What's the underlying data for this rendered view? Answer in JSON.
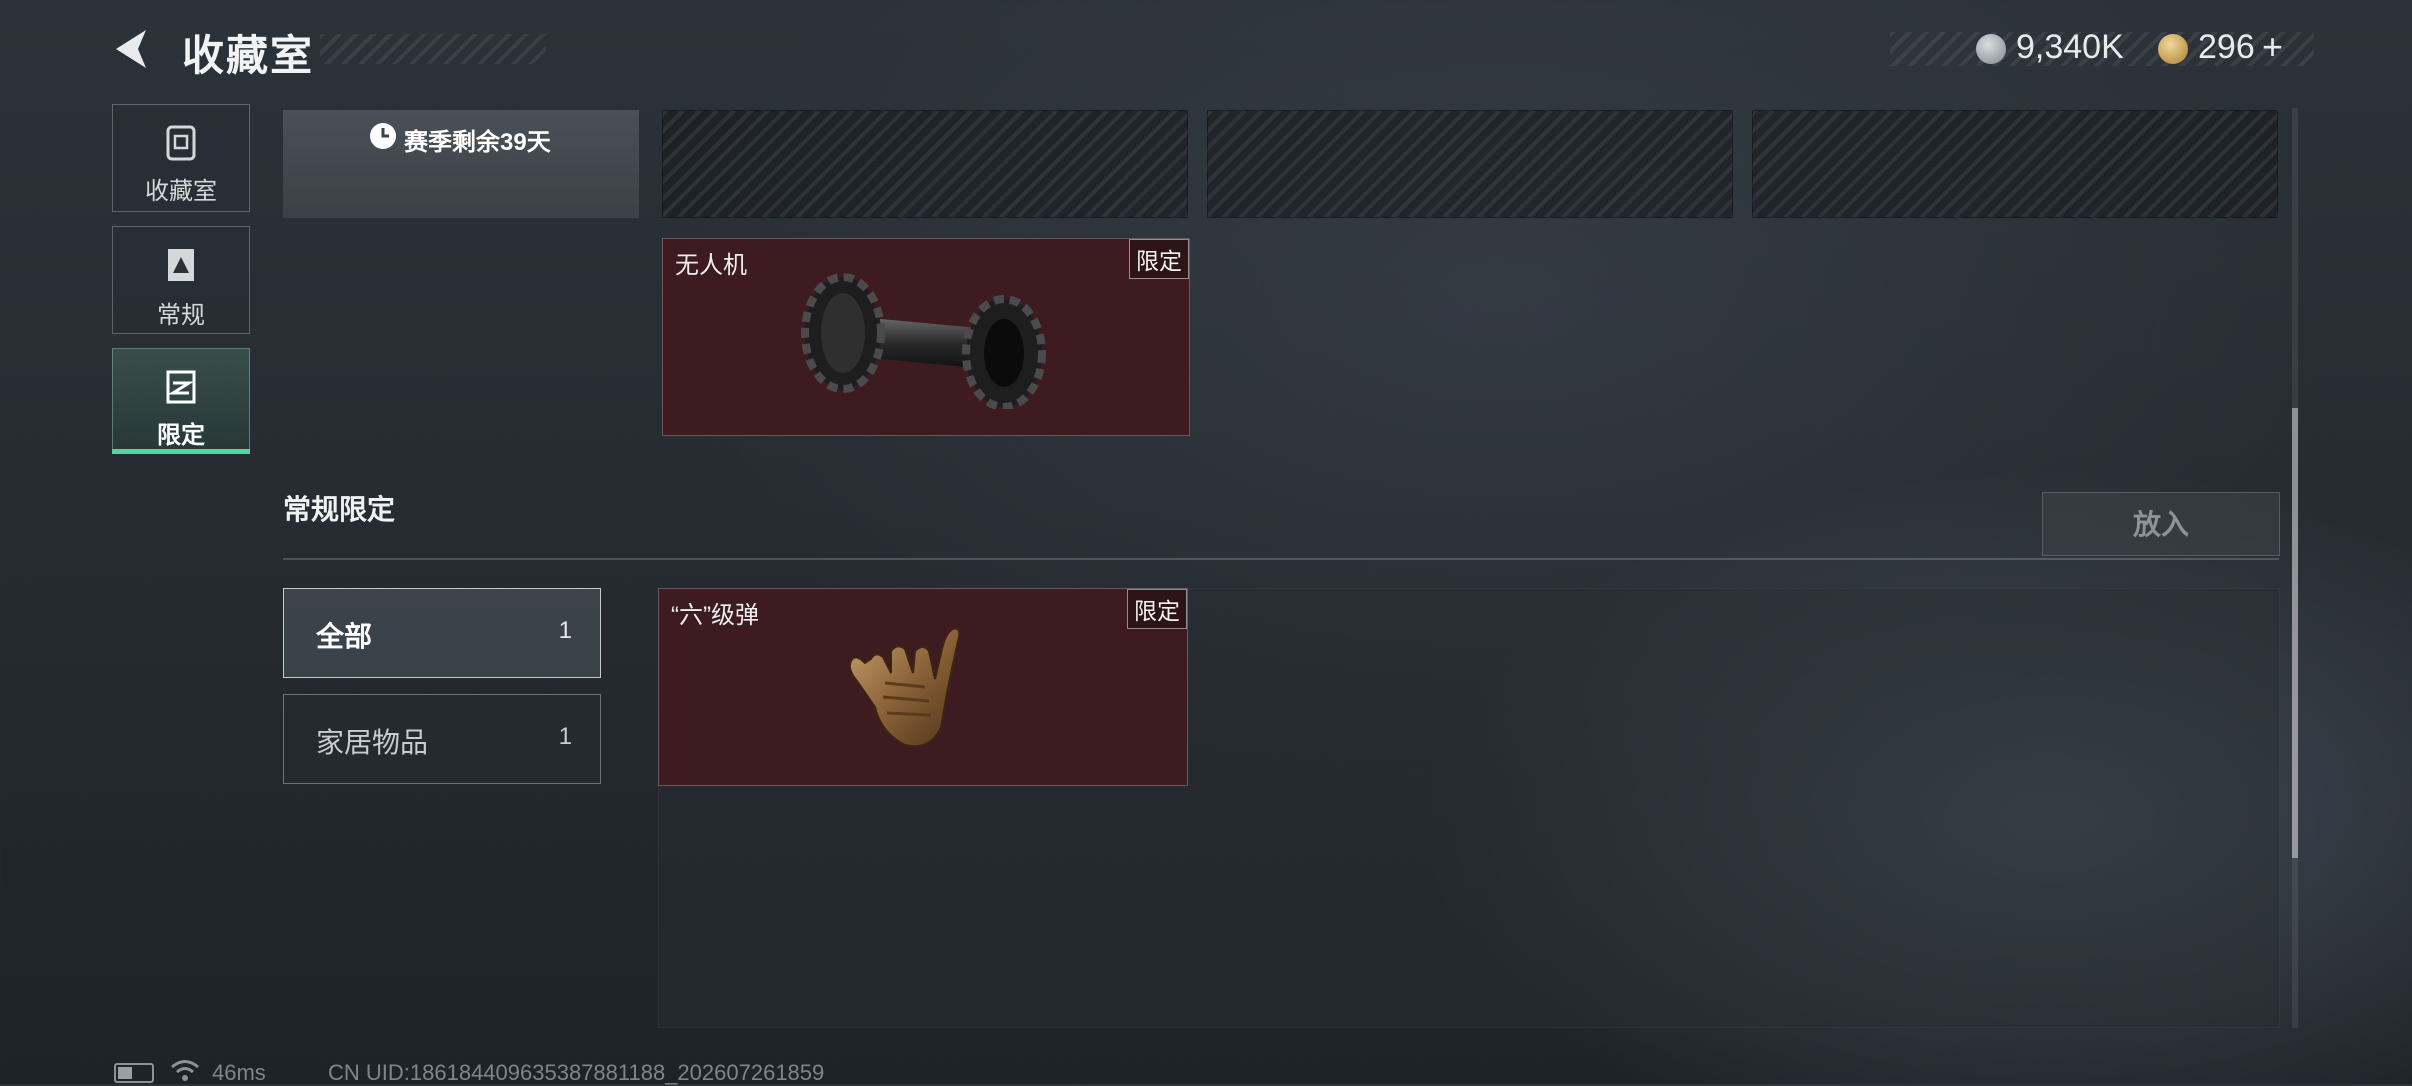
{
  "header": {
    "title": "收藏室",
    "currency_primary": "9,340K",
    "currency_secondary": "296",
    "add_symbol": "+"
  },
  "sidebar": {
    "items": [
      {
        "label": "收藏室",
        "icon": "collection-room-icon",
        "active": false
      },
      {
        "label": "常规",
        "icon": "regular-card-icon",
        "active": false
      },
      {
        "label": "限定",
        "icon": "limited-card-icon",
        "active": true
      }
    ]
  },
  "season": {
    "remaining": "赛季剩余39天",
    "icon": "clock-icon"
  },
  "top_items": [
    {
      "name": "无人机",
      "tag": "限定",
      "icon": "drone-tread-item-icon"
    }
  ],
  "section": {
    "title": "常规限定",
    "put_button": "放入"
  },
  "filters": [
    {
      "label": "全部",
      "count": "1",
      "selected": true
    },
    {
      "label": "家居物品",
      "count": "1",
      "selected": false
    }
  ],
  "grid_items": [
    {
      "name": "“六”级弹",
      "tag": "限定",
      "icon": "hand-gesture-item-icon"
    }
  ],
  "status_bar": {
    "ping": "46ms",
    "uid": "CN UID:186184409635387881188_202607261859"
  },
  "colors": {
    "accent_green": "#4fd9a0",
    "card_limited_bg": "#3d1b20",
    "background": "#262c32"
  }
}
